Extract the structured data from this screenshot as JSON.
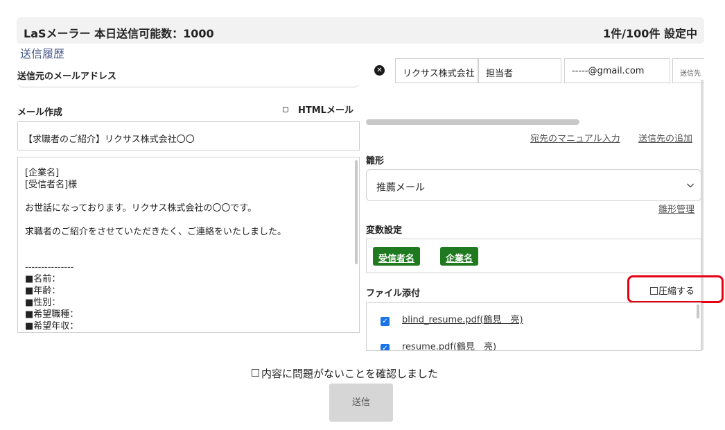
{
  "header": {
    "title": "LaSメーラー 本日送信可能数：1000",
    "status": "1件/100件 設定中"
  },
  "history_link": "送信履歴",
  "from": {
    "label": "送信元のメールアドレス"
  },
  "compose": {
    "label": "メール作成",
    "html_toggle": "HTMLメール",
    "subject": "【求職者のご紹介】リクサス株式会社〇〇",
    "body_lines": [
      "[企業名]",
      "[受信者名]様",
      "",
      "お世話になっております。リクサス株式会社の〇〇です。",
      "",
      "求職者のご紹介をさせていただきたく、ご連絡をいたしました。",
      "",
      "",
      "---------------",
      "■名前：",
      "■年齢：",
      "■性別：",
      "■希望職種：",
      "■希望年収："
    ]
  },
  "recipient": {
    "company": "リクサス株式会社",
    "person": "担当者",
    "email": "-----@gmail.com",
    "extra": "送信先"
  },
  "links": {
    "manual_input": "宛先のマニュアル入力",
    "add_recipient": "送信先の追加",
    "template_manage": "雛形管理"
  },
  "template": {
    "label": "雛形",
    "selected": "推薦メール"
  },
  "variables": {
    "label": "変数設定",
    "tags": [
      "受信者名",
      "企業名"
    ]
  },
  "attachments": {
    "label": "ファイル添付",
    "compress_label": "圧縮する",
    "files": [
      "blind_resume.pdf(鶴見　亮)",
      "resume.pdf(鶴見　亮)"
    ]
  },
  "confirm_label": "内容に問題がないことを確認しました",
  "send_label": "送信",
  "colors": {
    "highlight": "#e60012",
    "tag_green": "#1f7a1f",
    "check_blue": "#1a73e8"
  }
}
